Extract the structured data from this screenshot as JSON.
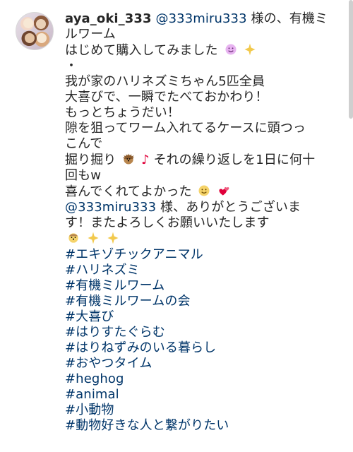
{
  "comment": {
    "username": "aya_oki_333",
    "mention": "@333miru333",
    "text_after_mention": " 様の、有機ミ",
    "line2": "ルワーム",
    "line3": "はじめて購入してみました",
    "line4": "・",
    "line5": "我が家のハリネズミちゃん5匹全員",
    "line6": "大喜びで、一瞬でたべておかわり！",
    "line7": "もっとちょうだい！",
    "line8": "隙を狙ってワーム入れてるケースに頭つっ",
    "line9": "こんで",
    "line10_a": "掘り掘り",
    "line10_b": "それの繰り返しを1日に何十",
    "line11": "回もw",
    "line12": "喜んでくれてよかった",
    "reply_mention": "@333miru333",
    "reply_text": " 様、ありがとうございま",
    "reply_line2": "す！またよろしくお願いいたします"
  },
  "hashtags": [
    "#エキゾチックアニマル",
    "#ハリネズミ",
    "#有機ミルワーム",
    "#有機ミルワームの会",
    "#大喜び",
    "#はりすたぐらむ",
    "#はりねずみのいる暮らし",
    "#おやつタイム",
    "#heghog",
    "#animal",
    "#小動物",
    "#動物好きな人と繋がりたい"
  ],
  "icons": {
    "avatar": "hedgehog-avatar",
    "emoji1": "smiling-face-emoji",
    "emoji2": "sparkles-emoji",
    "emoji3": "hedgehog-emoji",
    "emoji4": "musical-note-emoji",
    "emoji5": "smiling-face-emoji",
    "emoji6": "two-hearts-emoji",
    "emoji7": "hedgehog-face-emoji",
    "emoji8": "sparkles-emoji"
  },
  "colors": {
    "text": "#262626",
    "link": "#003569",
    "note": "#e0003a"
  }
}
